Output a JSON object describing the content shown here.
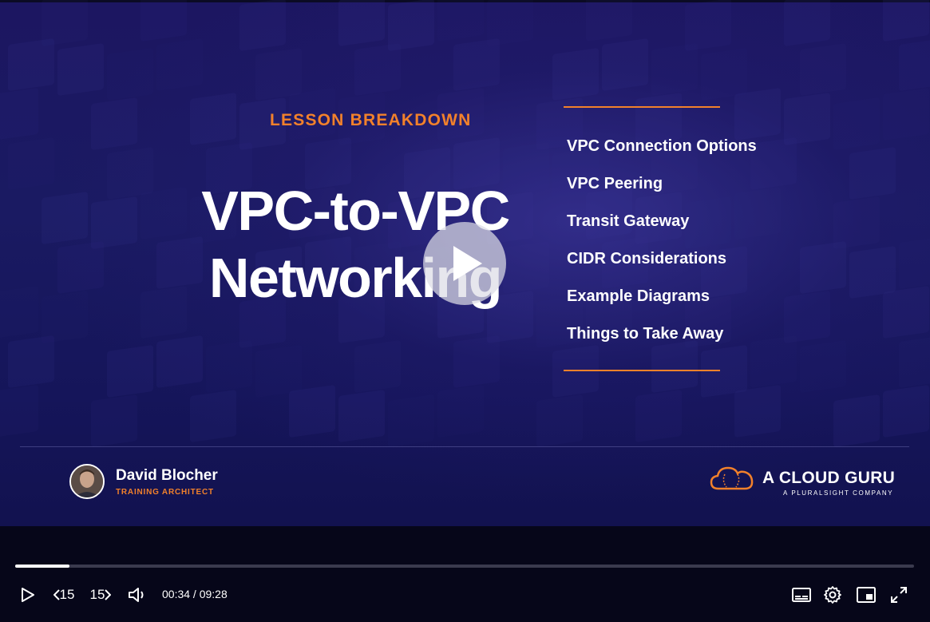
{
  "slide": {
    "kicker": "LESSON BREAKDOWN",
    "title_line1": "VPC-to-VPC",
    "title_line2": "Networking",
    "topics": [
      "VPC Connection Options",
      "VPC Peering",
      "Transit Gateway",
      "CIDR Considerations",
      "Example Diagrams",
      "Things to Take Away"
    ],
    "presenter": {
      "name": "David Blocher",
      "role": "TRAINING ARCHITECT"
    },
    "brand": {
      "name": "A CLOUD GURU",
      "tagline": "A PLURALSIGHT COMPANY"
    }
  },
  "player": {
    "skip_back_label": "15",
    "skip_forward_label": "15",
    "current_time": "00:34",
    "duration": "09:28",
    "time_separator": " / ",
    "progress_fraction": 0.06
  },
  "colors": {
    "accent": "#f2812b",
    "background": "#1a1a62"
  }
}
